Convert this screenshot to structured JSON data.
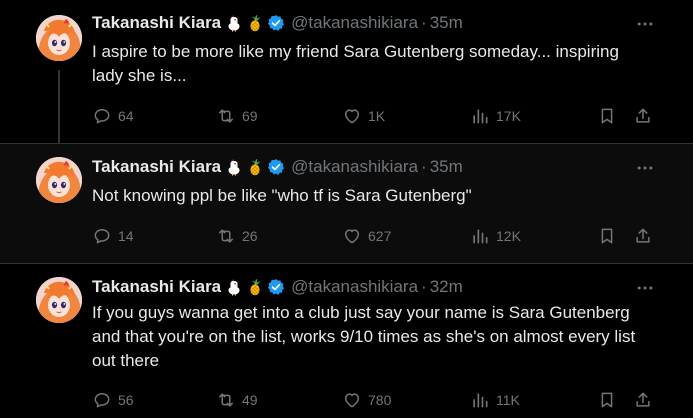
{
  "author": {
    "name": "Takanashi Kiara",
    "handle": "@takanashikiara",
    "emoji_icons": [
      "chicken-icon",
      "pineapple-icon"
    ],
    "verified_icon": "verified-badge-icon"
  },
  "colors": {
    "background": "#000000",
    "text": "#e7e9ea",
    "muted": "#71767b",
    "verified": "#1d9bf0",
    "divider": "#2f3336"
  },
  "tweets": [
    {
      "time": "35m",
      "text": "I aspire to be more like my friend Sara Gutenberg someday... inspiring lady she is...",
      "replies": "64",
      "retweets": "69",
      "likes": "1K",
      "views": "17K"
    },
    {
      "time": "35m",
      "text": "Not knowing ppl be like \"who tf is Sara Gutenberg\"",
      "replies": "14",
      "retweets": "26",
      "likes": "627",
      "views": "12K"
    },
    {
      "time": "32m",
      "text": "If you guys wanna get into a club just say your name is Sara Gutenberg and that you're on the list, works 9/10 times as she's on almost every list out there",
      "replies": "56",
      "retweets": "49",
      "likes": "780",
      "views": "11K"
    }
  ],
  "separator": "·"
}
